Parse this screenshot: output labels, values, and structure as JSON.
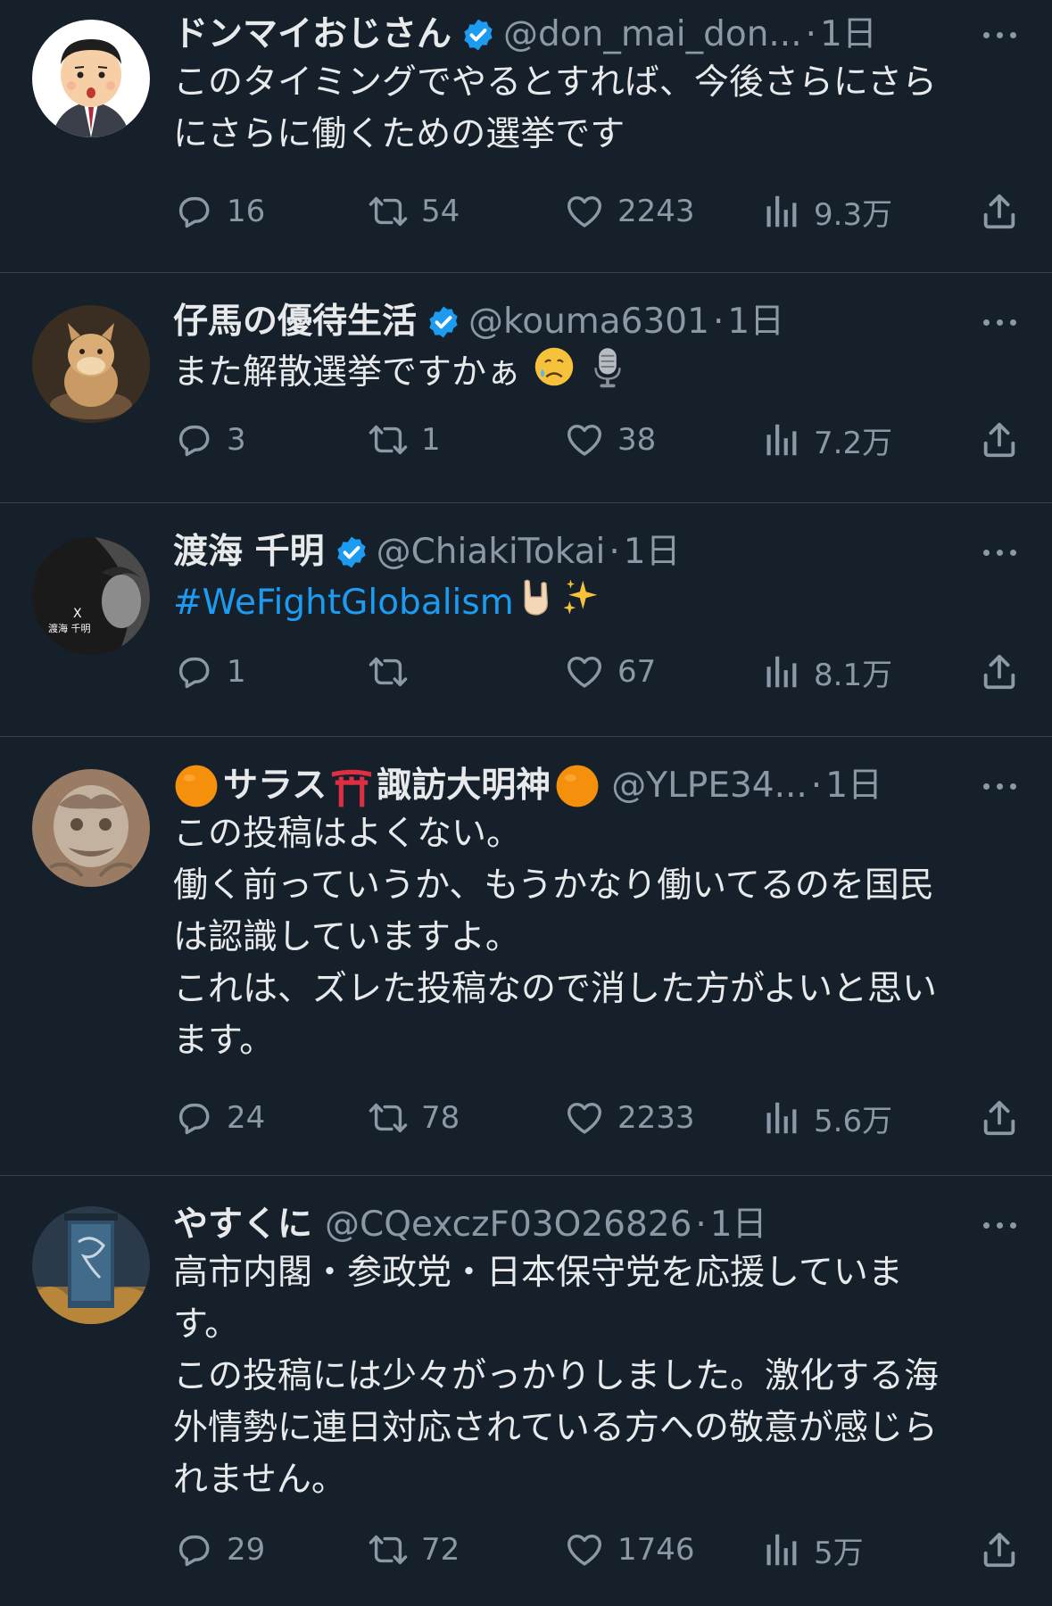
{
  "colors": {
    "background": "#15202b",
    "text_primary": "#e7e9ea",
    "text_secondary": "#8b98a5",
    "link": "#1d9bf0",
    "verified_badge": "#1d9bf0",
    "divider": "#38444d"
  },
  "tweets": [
    {
      "name": "ドンマイおじさん",
      "verified": true,
      "handle": "@don_mai_don...",
      "dot": "·",
      "time": "1日",
      "text": "このタイミングでやるとすれば、今後さらにさら\nにさらに働くための選挙です",
      "replies": "16",
      "retweets": "54",
      "likes": "2243",
      "views": "9.3万",
      "avatar_icon": "cartoon-man-avatar"
    },
    {
      "name": "仔馬の優待生活",
      "verified": true,
      "handle": "@kouma6301",
      "dot": "·",
      "time": "1日",
      "text": "また解散選挙ですかぁ",
      "emojis": [
        "sad-face-emoji",
        "microphone-emoji"
      ],
      "replies": "3",
      "retweets": "1",
      "likes": "38",
      "views": "7.2万",
      "avatar_icon": "pony-plush-avatar"
    },
    {
      "name": "渡海 千明",
      "verified": true,
      "handle": "@ChiakiTokai",
      "dot": "·",
      "time": "1日",
      "hashtag": "#WeFightGlobalism",
      "emojis": [
        "horns-hand-emoji",
        "sparkles-emoji"
      ],
      "replies": "1",
      "retweets": "",
      "likes": "67",
      "views": "8.1万",
      "avatar_icon": "portrait-avatar",
      "avatar_text": "渡海 千明"
    },
    {
      "name_prefix_emoji": "orange-circle-emoji",
      "name": "サラス",
      "name_mid_emoji": "torii-gate-emoji",
      "name_suffix": "諏訪大明神",
      "name_suffix_emoji": "orange-circle-emoji",
      "verified": false,
      "handle": "@YLPE34...",
      "dot": "·",
      "time": "1日",
      "text": "この投稿はよくない。\n働く前っていうか、もうかなり働いてるのを国民\nは認識していますよ。\nこれは、ズレた投稿なので消した方がよいと思い\nます。",
      "replies": "24",
      "retweets": "78",
      "likes": "2233",
      "views": "5.6万",
      "avatar_icon": "dragon-carving-avatar"
    },
    {
      "name": "やすくに",
      "verified": false,
      "handle": "@CQexczF03O26826",
      "dot": "·",
      "time": "1日",
      "text": "高市内閣・参政党・日本保守党を応援していま\nす。\nこの投稿には少々がっかりしました。激化する海\n外情勢に連日対応されている方への敬意が感じら\nれません。",
      "replies": "29",
      "retweets": "72",
      "likes": "1746",
      "views": "5万",
      "avatar_icon": "shrine-banner-avatar"
    }
  ]
}
